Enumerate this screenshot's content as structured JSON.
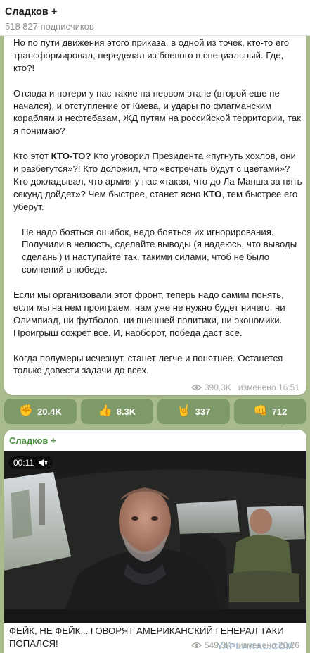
{
  "header": {
    "channel_name": "Сладков +",
    "subscribers": "518 827 подписчиков"
  },
  "post1": {
    "paragraphs": [
      [
        {
          "t": "Но по пути движения этого приказа, в одной из точек, кто-то его трансформировал, переделал из боевого в специальный. Где, кто?!"
        }
      ],
      [
        {
          "t": "Отсюда и потери у нас такие на первом этапе (второй еще не начался), и отступление от Киева, и удары по флагманским кораблям и нефтебазам, ЖД путям на российской территории, так я понимаю?"
        }
      ],
      [
        {
          "t": "Кто этот "
        },
        {
          "t": "КТО-ТО?",
          "b": true
        },
        {
          "t": " Кто уговорил Президента «пугнуть хохлов, они и разбегутся»?! Кто доложил, что «встречать будут с цветами»? Кто докладывал, что армия у нас «такая, что до Ла-Манша за пять секунд дойдет»?  Чем быстрее, станет ясно "
        },
        {
          "t": "КТО",
          "b": true
        },
        {
          "t": ", тем быстрее его уберут."
        }
      ],
      [
        {
          "t": " Не надо бояться ошибок, надо бояться их игнорирования. Получили в челюсть, сделайте выводы (я надеюсь, что выводы сделаны) и наступайте так, такими силами, чтоб не было сомнений в победе.",
          "indent": true
        }
      ],
      [
        {
          "t": "Если мы организовали этот фронт, теперь надо самим понять, если мы на нем проиграем, нам уже не нужно будет ничего, ни Олимпиад, ни футболов, ни внешней политики, ни экономики. Проигрыш сожрет все. И, наоборот, победа даст все."
        }
      ],
      [
        {
          "t": "Когда полумеры исчезнут, станет легче и понятнее. Останется только довести задачи до всех."
        }
      ]
    ],
    "views": "390,3K",
    "edited_label": "изменено 16:51"
  },
  "reactions": [
    {
      "emoji": "✊",
      "count": "20.4K"
    },
    {
      "emoji": "👍",
      "count": "8.3K"
    },
    {
      "emoji": "🤘",
      "count": "337"
    },
    {
      "emoji": "👊",
      "count": "712"
    }
  ],
  "post2": {
    "author": "Сладков +",
    "video_time": "00:11",
    "caption": "ФЕЙК, НЕ ФЕЙК... ГОВОРЯТ АМЕРИКАНСКИЙ ГЕНЕРАЛ ТАКИ ПОПАЛСЯ!",
    "watermark": "YAPLAKAL.COM",
    "views": "549,3K",
    "edited_label": "изменено 20:26"
  },
  "icons": {
    "views": "eye-icon",
    "mute": "speaker-muted-icon"
  },
  "colors": {
    "background": "#a9bb8c",
    "reaction_bg": "#7e9a69",
    "author_green": "#4e8f42",
    "meta_gray": "#a7aba4"
  }
}
